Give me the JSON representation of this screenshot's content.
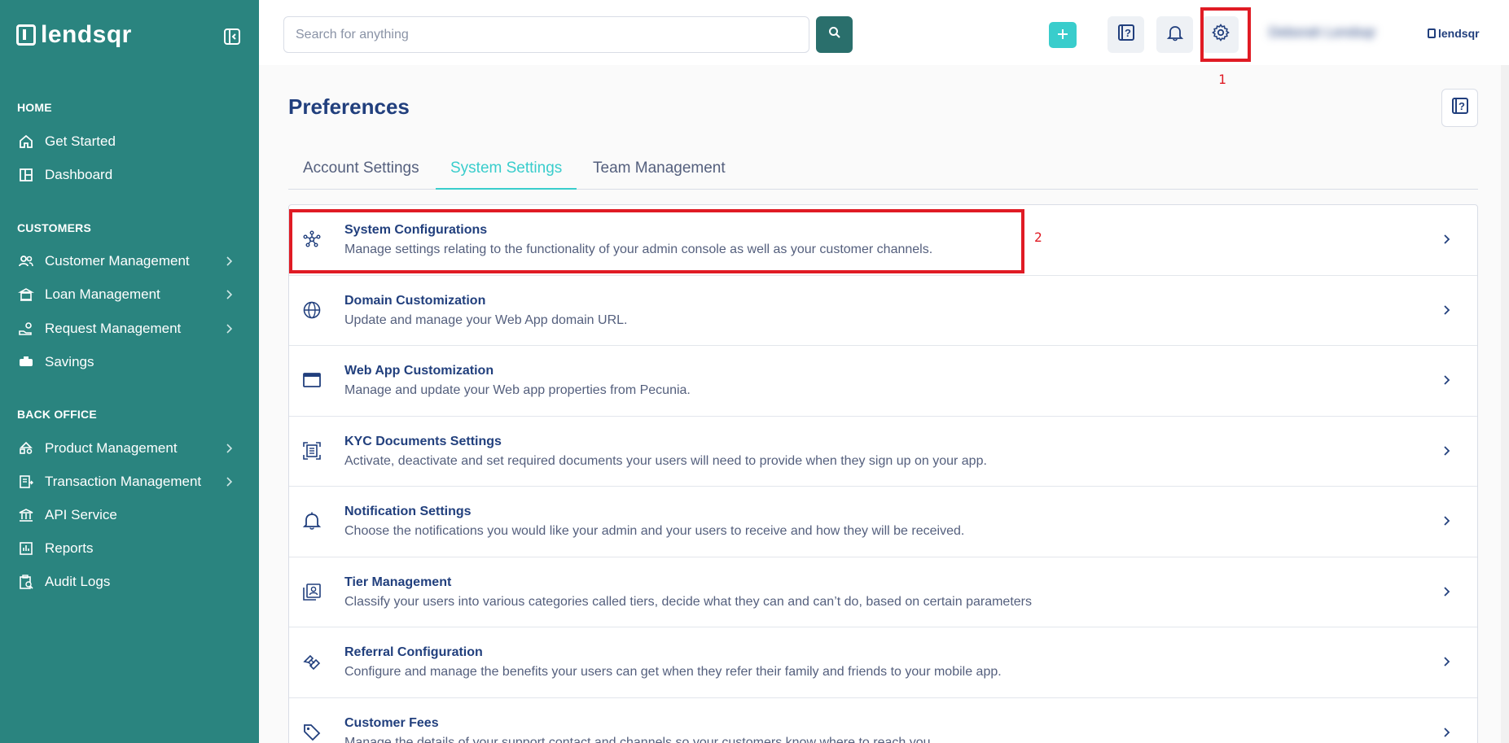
{
  "brand": {
    "name": "lendsqr"
  },
  "sidebar": {
    "sections": [
      {
        "label": "HOME"
      },
      {
        "label": "CUSTOMERS"
      },
      {
        "label": "BACK OFFICE"
      }
    ],
    "items": [
      {
        "label": "Get Started",
        "icon": "home-icon"
      },
      {
        "label": "Dashboard",
        "icon": "dashboard-icon"
      },
      {
        "label": "Customer Management",
        "icon": "users-icon"
      },
      {
        "label": "Loan Management",
        "icon": "loan-icon"
      },
      {
        "label": "Request Management",
        "icon": "request-icon"
      },
      {
        "label": "Savings",
        "icon": "piggy-bank-icon"
      },
      {
        "label": "Product Management",
        "icon": "product-icon"
      },
      {
        "label": "Transaction Management",
        "icon": "transaction-icon"
      },
      {
        "label": "API Service",
        "icon": "bank-icon"
      },
      {
        "label": "Reports",
        "icon": "reports-icon"
      },
      {
        "label": "Audit Logs",
        "icon": "audit-icon"
      }
    ]
  },
  "topbar": {
    "search_placeholder": "Search for anything",
    "user_name": "Deborah Lendsqr",
    "logo_text": "lendsqr"
  },
  "annotations": {
    "first": "1",
    "second": "2"
  },
  "page": {
    "title": "Preferences"
  },
  "tabs": [
    {
      "label": "Account Settings",
      "active": false
    },
    {
      "label": "System Settings",
      "active": true
    },
    {
      "label": "Team Management",
      "active": false
    }
  ],
  "settings": [
    {
      "title": "System Configurations",
      "desc": "Manage settings relating to the functionality of your admin console as well as your customer channels.",
      "icon": "network-icon"
    },
    {
      "title": "Domain Customization",
      "desc": "Update and manage your Web App domain URL.",
      "icon": "globe-icon"
    },
    {
      "title": "Web App Customization",
      "desc": "Manage and update your Web app properties from Pecunia.",
      "icon": "browser-window-icon"
    },
    {
      "title": "KYC Documents Settings",
      "desc": "Activate, deactivate and set required documents your users will need to provide when they sign up on your app.",
      "icon": "document-scan-icon"
    },
    {
      "title": "Notification Settings",
      "desc": "Choose the notifications you would like your admin and your users to receive and how they will be received.",
      "icon": "bell-icon"
    },
    {
      "title": "Tier Management",
      "desc": "Classify your users into various categories called tiers, decide what they can and can’t do, based on certain parameters",
      "icon": "user-card-icon"
    },
    {
      "title": "Referral Configuration",
      "desc": "Configure and manage the benefits your users can get when they refer their family and friends to your mobile app.",
      "icon": "handshake-icon"
    },
    {
      "title": "Customer Fees",
      "desc": "Manage the details of your support contact and channels so your customers know where to reach you.",
      "icon": "tag-icon"
    }
  ],
  "colors": {
    "sidebar": "#2a847f",
    "accent": "#39cdcc",
    "navy": "#213f7d",
    "annotation": "#e01b24"
  }
}
